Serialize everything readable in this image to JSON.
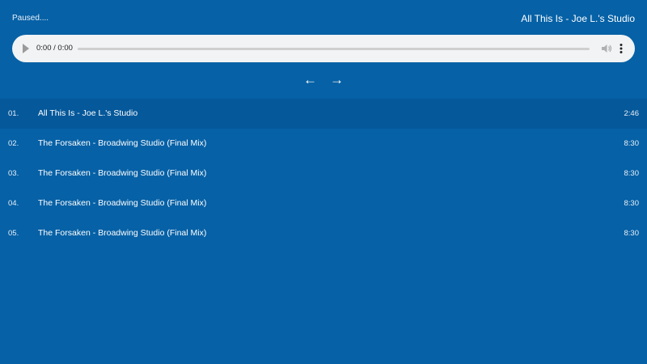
{
  "status_text": "Paused....",
  "now_playing_title": "All This Is - Joe L.'s Studio",
  "player": {
    "time_display": "0:00 / 0:00",
    "progress_fraction": 0,
    "play_icon": "play-icon",
    "volume_icon": "volume-icon",
    "menu_icon": "more-vertical-icon"
  },
  "nav": {
    "prev_label": "←",
    "next_label": "→"
  },
  "tracks": [
    {
      "number": "01.",
      "title": "All This Is - Joe L.'s Studio",
      "duration": "2:46",
      "active": true
    },
    {
      "number": "02.",
      "title": "The Forsaken - Broadwing Studio (Final Mix)",
      "duration": "8:30",
      "active": false
    },
    {
      "number": "03.",
      "title": "The Forsaken - Broadwing Studio (Final Mix)",
      "duration": "8:30",
      "active": false
    },
    {
      "number": "04.",
      "title": "The Forsaken - Broadwing Studio (Final Mix)",
      "duration": "8:30",
      "active": false
    },
    {
      "number": "05.",
      "title": "The Forsaken - Broadwing Studio (Final Mix)",
      "duration": "8:30",
      "active": false
    }
  ],
  "colors": {
    "background": "#0661a6",
    "active_row": "#05589a",
    "player_bg": "#f1f3f4"
  }
}
